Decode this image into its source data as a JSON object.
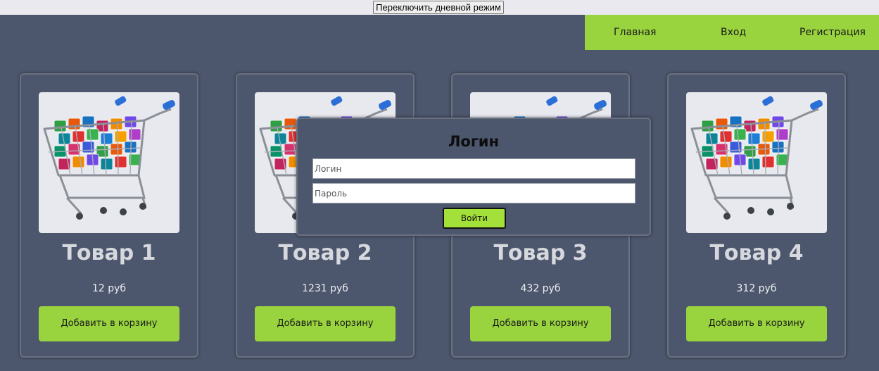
{
  "topbar": {
    "toggle_label": "Переключить дневной режим"
  },
  "nav": {
    "items": [
      "Главная",
      "Вход",
      "Регистрация"
    ]
  },
  "products": [
    {
      "title": "Товар 1",
      "price": "12 руб",
      "button": "Добавить в корзину"
    },
    {
      "title": "Товар 2",
      "price": "1231 руб",
      "button": "Добавить в корзину"
    },
    {
      "title": "Товар 3",
      "price": "432 руб",
      "button": "Добавить в корзину"
    },
    {
      "title": "Товар 4",
      "price": "312 руб",
      "button": "Добавить в корзину"
    }
  ],
  "login_modal": {
    "title": "Логин",
    "login_placeholder": "Логин",
    "password_placeholder": "Пароль",
    "submit_label": "Войти"
  },
  "colors": {
    "background": "#4c566c",
    "accent": "#99d43f",
    "topbar": "#e9e9ef"
  },
  "icons": {
    "product_image": "shopping-cart-with-app-icons"
  }
}
